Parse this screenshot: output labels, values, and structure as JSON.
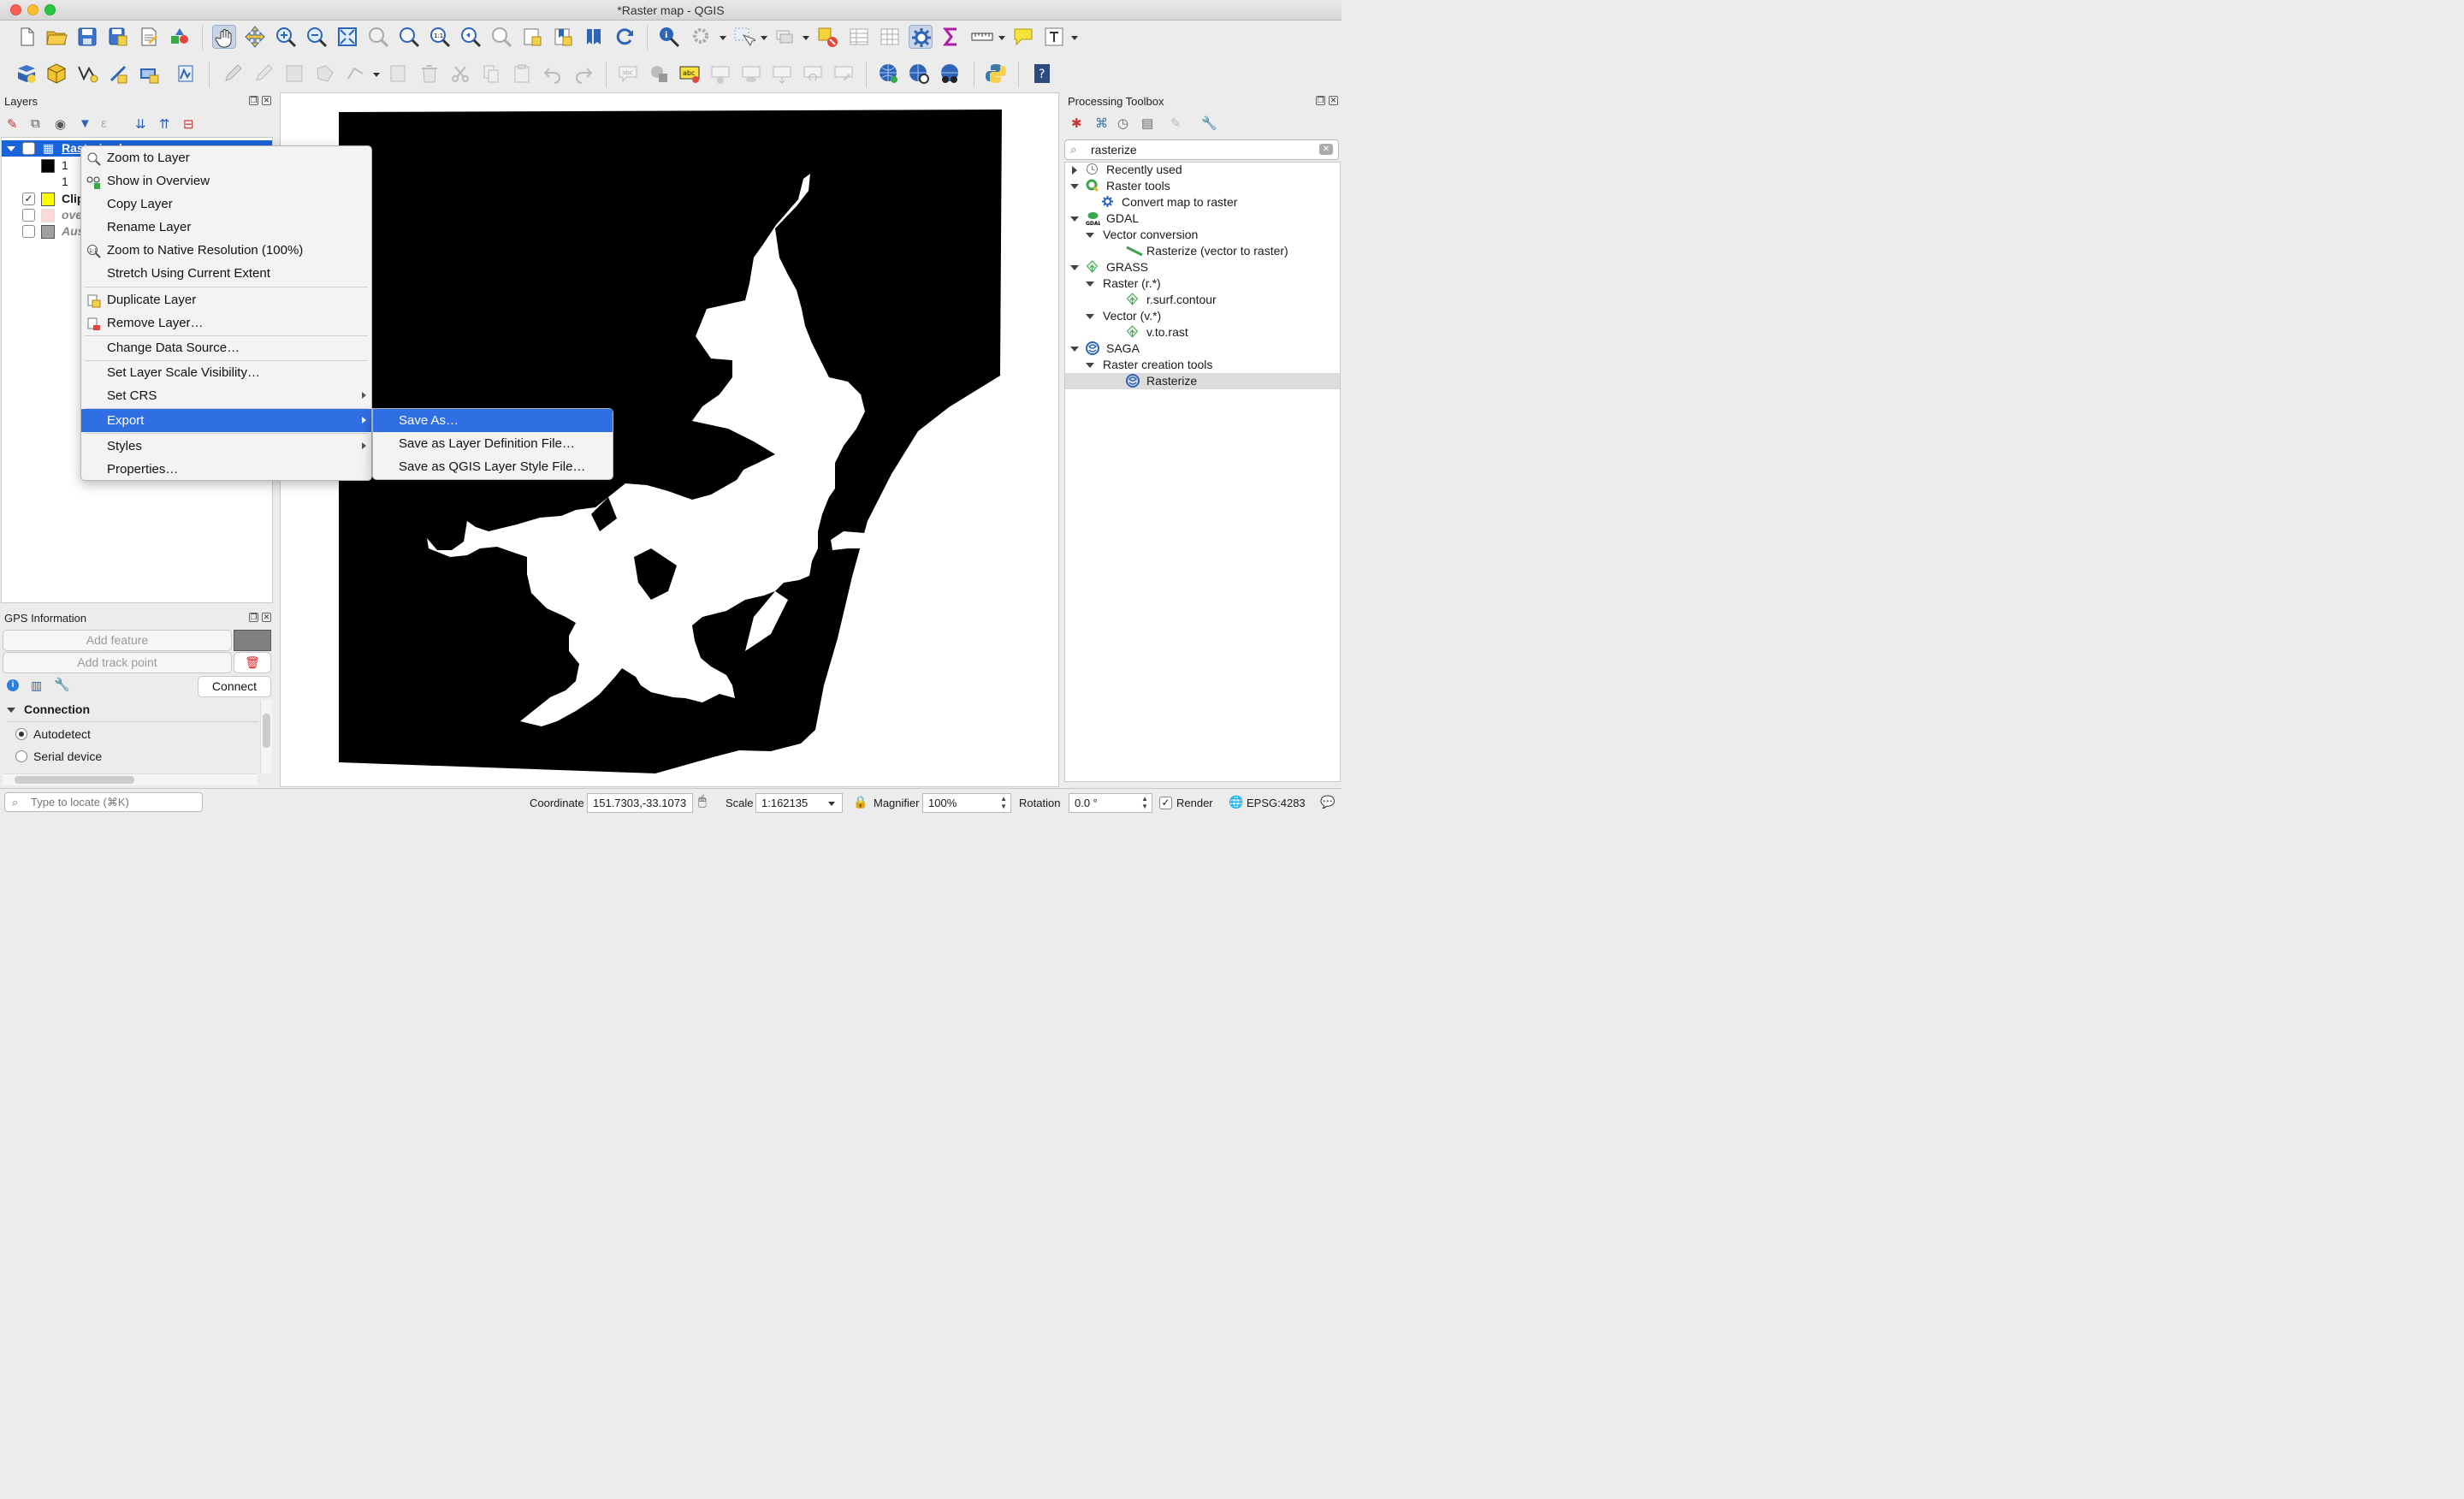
{
  "window": {
    "title": "*Raster map - QGIS"
  },
  "colors": {
    "accent": "#2f6ee3",
    "selection_row": "#1a64d9",
    "map_fill": "#000000"
  },
  "layers_panel": {
    "title": "Layers",
    "items": [
      {
        "label": "Rasterized",
        "checked": true,
        "selected": true
      },
      {
        "label": "1"
      },
      {
        "label": "1"
      },
      {
        "label": "Clip",
        "checked": true,
        "swatch": "#ffff00"
      },
      {
        "label": "ove",
        "checked": false,
        "swatch": "#ffd8d8"
      },
      {
        "label": "Aus",
        "checked": false,
        "swatch": "#a0a0a0"
      }
    ]
  },
  "context_menu": {
    "items": [
      {
        "label": "Zoom to Layer",
        "icon": "zoom-layer-icon"
      },
      {
        "label": "Show in Overview",
        "icon": "overview-icon"
      },
      {
        "label": "Copy Layer"
      },
      {
        "label": "Rename Layer"
      },
      {
        "label": "Zoom to Native Resolution (100%)",
        "icon": "native-res-icon"
      },
      {
        "label": "Stretch Using Current Extent"
      },
      {
        "label": "Duplicate Layer",
        "icon": "duplicate-icon"
      },
      {
        "label": "Remove Layer…",
        "icon": "remove-layer-icon"
      },
      {
        "label": "Change Data Source…"
      },
      {
        "label": "Set Layer Scale Visibility…"
      },
      {
        "label": "Set CRS",
        "submenu": true
      },
      {
        "label": "Export",
        "submenu": true,
        "highlighted": true
      },
      {
        "label": "Styles",
        "submenu": true
      },
      {
        "label": "Properties…"
      }
    ]
  },
  "export_submenu": {
    "items": [
      {
        "label": "Save As…",
        "highlighted": true
      },
      {
        "label": "Save as Layer Definition File…"
      },
      {
        "label": "Save as QGIS Layer Style File…"
      }
    ]
  },
  "gps_panel": {
    "title": "GPS Information",
    "add_feature": "Add feature",
    "add_track_point": "Add track point",
    "connect": "Connect",
    "section": "Connection",
    "options": [
      "Autodetect",
      "Serial device"
    ],
    "selected_option": "Autodetect"
  },
  "toolbox": {
    "title": "Processing Toolbox",
    "search_value": "rasterize",
    "tree": [
      {
        "label": "Recently used",
        "level": 0,
        "expanded": false,
        "icon": "clock-icon"
      },
      {
        "label": "Raster tools",
        "level": 0,
        "expanded": true,
        "icon": "qgis-icon"
      },
      {
        "label": "Convert map to raster",
        "level": 1,
        "icon": "gear-icon"
      },
      {
        "label": "GDAL",
        "level": 0,
        "expanded": true,
        "icon": "gdal-icon"
      },
      {
        "label": "Vector conversion",
        "level": 1,
        "expanded": true
      },
      {
        "label": "Rasterize (vector to raster)",
        "level": 2,
        "icon": "gdal-tool-icon"
      },
      {
        "label": "GRASS",
        "level": 0,
        "expanded": true,
        "icon": "grass-icon"
      },
      {
        "label": "Raster (r.*)",
        "level": 1,
        "expanded": true
      },
      {
        "label": "r.surf.contour",
        "level": 2,
        "icon": "grass-icon"
      },
      {
        "label": "Vector (v.*)",
        "level": 1,
        "expanded": true
      },
      {
        "label": "v.to.rast",
        "level": 2,
        "icon": "grass-icon"
      },
      {
        "label": "SAGA",
        "level": 0,
        "expanded": true,
        "icon": "saga-icon"
      },
      {
        "label": "Raster creation tools",
        "level": 1,
        "expanded": true
      },
      {
        "label": "Rasterize",
        "level": 2,
        "icon": "saga-icon",
        "selected": true
      }
    ]
  },
  "statusbar": {
    "locator_placeholder": "Type to locate (⌘K)",
    "coordinate_label": "Coordinate",
    "coordinate_value": "151.7303,-33.1073",
    "scale_label": "Scale",
    "scale_value": "1:162135",
    "magnifier_label": "Magnifier",
    "magnifier_value": "100%",
    "rotation_label": "Rotation",
    "rotation_value": "0.0 °",
    "render_label": "Render",
    "render_checked": true,
    "crs": "EPSG:4283"
  }
}
